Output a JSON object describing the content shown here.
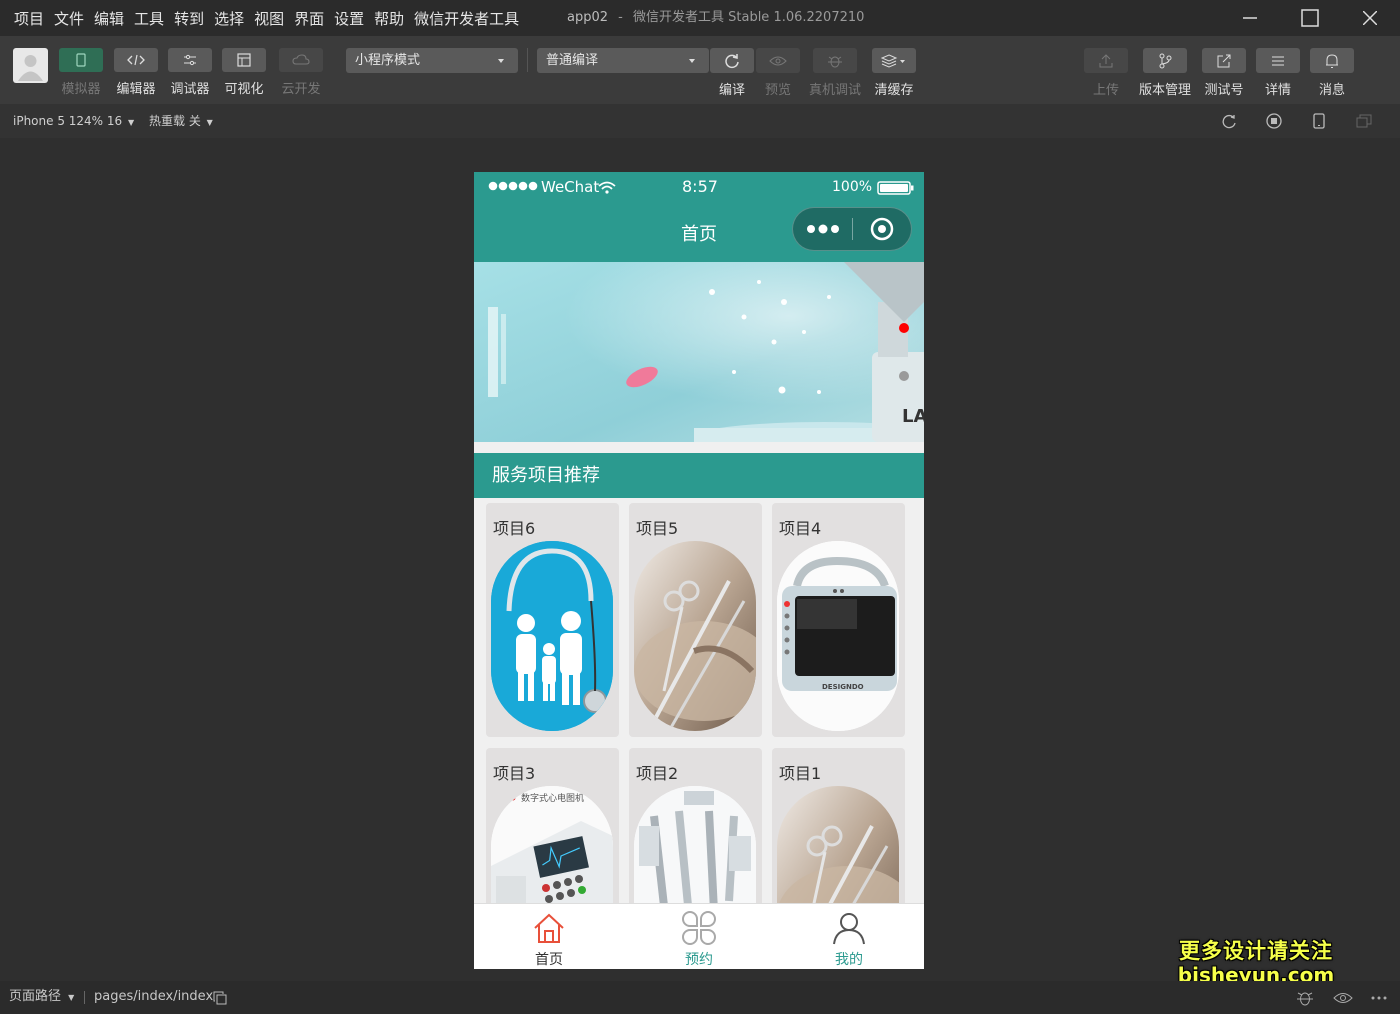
{
  "menu": [
    "项目",
    "文件",
    "编辑",
    "工具",
    "转到",
    "选择",
    "视图",
    "界面",
    "设置",
    "帮助",
    "微信开发者工具"
  ],
  "window": {
    "app": "app02",
    "sep": "-",
    "title": "微信开发者工具 Stable 1.06.2207210"
  },
  "toolbar": {
    "simulator": "模拟器",
    "editor": "编辑器",
    "debugger": "调试器",
    "visual": "可视化",
    "cloud": "云开发",
    "mode_select": "小程序模式",
    "compile_select": "普通编译",
    "compile": "编译",
    "preview": "预览",
    "realdebug": "真机调试",
    "clearcache": "清缓存",
    "upload": "上传",
    "version": "版本管理",
    "testid": "测试号",
    "details": "详情",
    "messages": "消息"
  },
  "subbar": {
    "device": "iPhone 5 124% 16",
    "hotreload": "热重载 关"
  },
  "phone": {
    "status": {
      "carrier": "WeChat",
      "time": "8:57",
      "battery": "100%"
    },
    "nav_title": "首页",
    "section_title": "服务项目推荐",
    "items": [
      {
        "title": "项目6",
        "image": "family-medical-image"
      },
      {
        "title": "项目5",
        "image": "surgical-tools-image"
      },
      {
        "title": "项目4",
        "image": "monitor-device-image"
      },
      {
        "title": "项目3",
        "image": "ecg-machine-image",
        "caption": "数字式心电图机"
      },
      {
        "title": "项目2",
        "image": "surgical-robot-image"
      },
      {
        "title": "项目1",
        "image": "surgical-tools-image"
      }
    ],
    "tabs": [
      {
        "label": "首页",
        "icon": "home-icon",
        "color": "#333333"
      },
      {
        "label": "预约",
        "icon": "grid-flower-icon",
        "color": "#2b9a8f"
      },
      {
        "label": "我的",
        "icon": "user-icon",
        "color": "#2b9a8f"
      }
    ],
    "accent": "#2b9a8f",
    "active_icon_color": "#e8503a"
  },
  "footer": {
    "path_label": "页面路径",
    "path": "pages/index/index"
  },
  "watermark": {
    "line1": "更多设计请关注",
    "line2": "bisheyun.com"
  }
}
